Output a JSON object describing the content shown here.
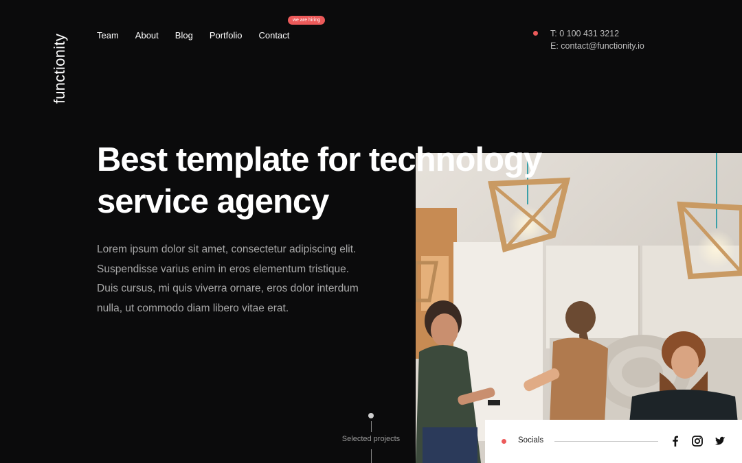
{
  "brand": {
    "logo_text": "functionity"
  },
  "nav": {
    "items": [
      {
        "label": "Team"
      },
      {
        "label": "About"
      },
      {
        "label": "Blog"
      },
      {
        "label": "Portfolio"
      },
      {
        "label": "Contact"
      }
    ],
    "hiring_badge": "we are hiring"
  },
  "contact": {
    "phone": "T: 0 100 431 3212",
    "email": "E: contact@functionity.io"
  },
  "hero": {
    "title_line1": "Best template for technology",
    "title_line2": "service agency",
    "description": "Lorem ipsum dolor sit amet, consectetur adipiscing elit. Suspendisse varius enim in eros elementum tristique. Duis cursus, mi quis viverra ornare, eros dolor interdum nulla, ut commodo diam libero vitae erat."
  },
  "scroll": {
    "label": "Selected projects"
  },
  "socials": {
    "label": "Socials",
    "icons": [
      "facebook-icon",
      "instagram-icon",
      "twitter-icon"
    ]
  },
  "colors": {
    "background": "#0b0b0c",
    "accent": "#ec5a5a",
    "text_primary": "#ffffff",
    "text_secondary": "#a8a8a8"
  }
}
